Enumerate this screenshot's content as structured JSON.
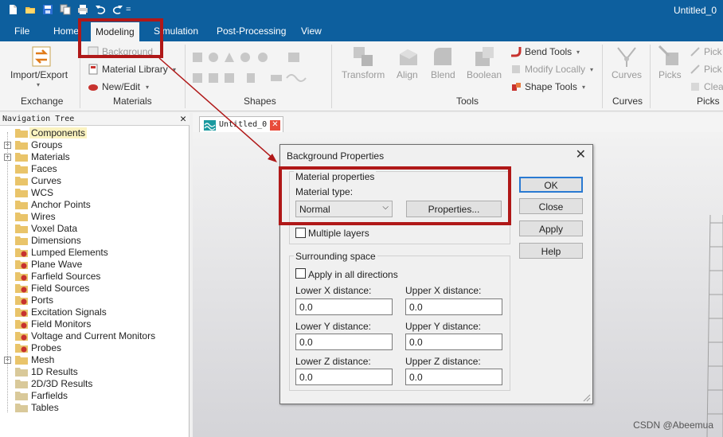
{
  "app": {
    "title": "Untitled_0",
    "quick_access": [
      "new-file-icon",
      "open-folder-icon",
      "save-icon",
      "copy-icon",
      "print-icon",
      "undo-icon",
      "redo-icon",
      "customize-icon"
    ],
    "quick_access_more": "="
  },
  "ribbon_tabs": [
    "File",
    "Home",
    "Modeling",
    "Simulation",
    "Post-Processing",
    "View"
  ],
  "active_tab": "Modeling",
  "ribbon": {
    "exchange": {
      "import_export": "Import/Export",
      "group_label": "Exchange"
    },
    "materials": {
      "background": "Background",
      "material_library": "Material Library",
      "new_edit": "New/Edit",
      "group_label": "Materials"
    },
    "shapes": {
      "group_label": "Shapes"
    },
    "tools": {
      "transform": "Transform",
      "align": "Align",
      "blend": "Blend",
      "boolean": "Boolean",
      "bend_tools": "Bend Tools",
      "modify_locally": "Modify Locally",
      "shape_tools": "Shape Tools",
      "group_label": "Tools"
    },
    "curves": {
      "curves": "Curves",
      "group_label": "Curves"
    },
    "picks": {
      "picks": "Picks",
      "pick1": "Pick",
      "pick2": "Pick",
      "clear": "Clea",
      "group_label": "Picks"
    },
    "dropdown_caret": "▾"
  },
  "nav_tree": {
    "title": "Navigation Tree",
    "close": "✕",
    "expand_symbol": "+",
    "items": [
      "Components",
      "Groups",
      "Materials",
      "Faces",
      "Curves",
      "WCS",
      "Anchor Points",
      "Wires",
      "Voxel Data",
      "Dimensions",
      "Lumped Elements",
      "Plane Wave",
      "Farfield Sources",
      "Field Sources",
      "Ports",
      "Excitation Signals",
      "Field Monitors",
      "Voltage and Current Monitors",
      "Probes",
      "Mesh",
      "1D Results",
      "2D/3D Results",
      "Farfields",
      "Tables"
    ]
  },
  "document_tab": {
    "label": "Untitled_0",
    "close": "✕"
  },
  "dialog": {
    "title": "Background Properties",
    "close": "✕",
    "material_properties": "Material properties",
    "material_type_label": "Material type:",
    "material_type_value": "Normal",
    "combo_arrow": "⌵",
    "properties_button": "Properties...",
    "multiple_layers": "Multiple layers",
    "surrounding_space": "Surrounding space",
    "apply_all_directions": "Apply in all directions",
    "lower_x_label": "Lower X distance:",
    "upper_x_label": "Upper X distance:",
    "lower_y_label": "Lower Y distance:",
    "upper_y_label": "Upper Y distance:",
    "lower_z_label": "Lower Z distance:",
    "upper_z_label": "Upper Z distance:",
    "lower_x": "0.0",
    "upper_x": "0.0",
    "lower_y": "0.0",
    "upper_y": "0.0",
    "lower_z": "0.0",
    "upper_z": "0.0",
    "ok": "OK",
    "close_button": "Close",
    "apply": "Apply",
    "help": "Help"
  },
  "watermark": "CSDN @Abeemua",
  "colors": {
    "titlebar": "#0d5f9e",
    "highlight": "#b01818",
    "default_button_border": "#2a7ad2"
  }
}
